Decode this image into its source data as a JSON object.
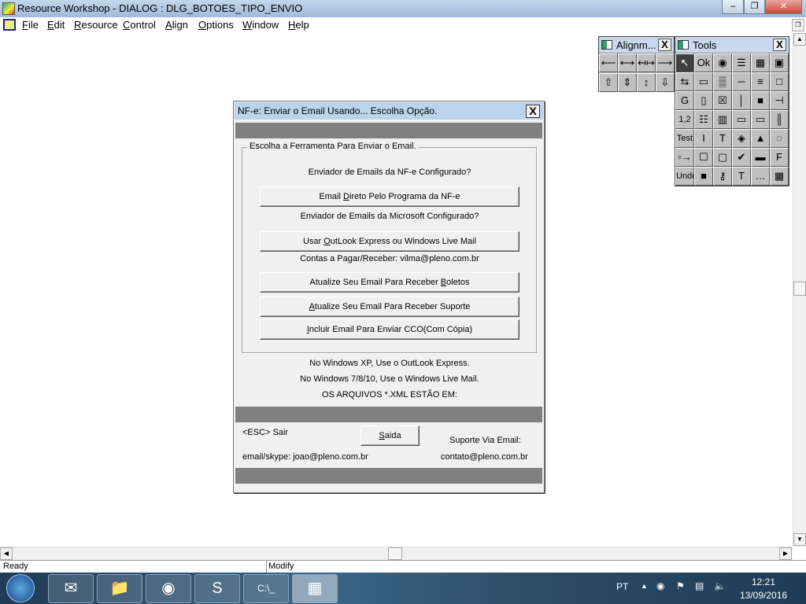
{
  "window": {
    "title": "Resource Workshop - DIALOG : DLG_BOTOES_TIPO_ENVIO",
    "minimize": "–",
    "restore": "❐",
    "close": "✕"
  },
  "menu": [
    {
      "key": "F",
      "rest": "ile"
    },
    {
      "key": "E",
      "rest": "dit"
    },
    {
      "key": "R",
      "rest": "esource"
    },
    {
      "key": "C",
      "rest": "ontrol"
    },
    {
      "key": "A",
      "rest": "lign"
    },
    {
      "key": "O",
      "rest": "ptions"
    },
    {
      "key": "W",
      "rest": "indow"
    },
    {
      "key": "H",
      "rest": "elp"
    }
  ],
  "alignment_palette": {
    "title": "Alignm...",
    "close": "X",
    "icons": [
      "⟵",
      "⟷",
      "↤↦",
      "⟶",
      "⇧",
      "⇕",
      "↕",
      "⇩"
    ]
  },
  "tools_palette": {
    "title": "Tools",
    "close": "X",
    "icons": [
      "↖",
      "Ok",
      "◉",
      "☰",
      "▦",
      "▣",
      "⇆",
      "▭",
      "▒",
      "─",
      "≡",
      "□",
      "G",
      "▯",
      "☒",
      "│",
      "■",
      "⊣",
      "1,2",
      "☷",
      "▥",
      "▭",
      "▭",
      "║",
      "Test",
      "I",
      "T",
      "◈",
      "▲",
      "◌",
      "▫→",
      "☐",
      "▢",
      "✔",
      "▬",
      "F",
      "Undo",
      "■",
      "⚷",
      "T",
      "…",
      "▦"
    ]
  },
  "dialog": {
    "title": "NF-e: Enviar o Email Usando... Escolha Opção.",
    "close": "X",
    "group_label": "Escolha a Ferramenta Para Enviar o Email.",
    "q1": "Enviador de Emails da NF-e Configurado?",
    "btn1": {
      "pre": "Email ",
      "key": "D",
      "post": "ireto Pelo Programa da NF-e"
    },
    "q2": "Enviador de Emails da Microsoft Configurado?",
    "btn2": {
      "pre": "Usar ",
      "key": "O",
      "post": "utLook Express ou Windows Live Mail"
    },
    "contas": "Contas a Pagar/Receber: vilma@pleno.com.br",
    "btn3": {
      "pre": "Atualize Seu Email Para Receber ",
      "key": "B",
      "post": "oletos"
    },
    "btn4": {
      "pre": "",
      "key": "A",
      "post": "tualize Seu Email Para Receber Suporte"
    },
    "btn5": {
      "pre": "",
      "key": "I",
      "post": "ncluir Email Para Enviar CCO(Com Cópia)"
    },
    "note1": "No Windows XP, Use o OutLook Express.",
    "note2": "No Windows 7/8/10, Use o Windows Live Mail.",
    "note3": "OS ARQUIVOS *.XML ESTÃO EM:",
    "esc": "<ESC> Sair",
    "saida": {
      "pre": "",
      "key": "S",
      "post": "aida"
    },
    "suporte": "Suporte Via Email:",
    "email_skype": "email/skype: joao@pleno.com.br",
    "contato": "contato@pleno.com.br"
  },
  "status": {
    "left": "Ready",
    "right": "Modify"
  },
  "taskbar": {
    "language": "PT",
    "time": "12:21",
    "date": "13/09/2016"
  }
}
